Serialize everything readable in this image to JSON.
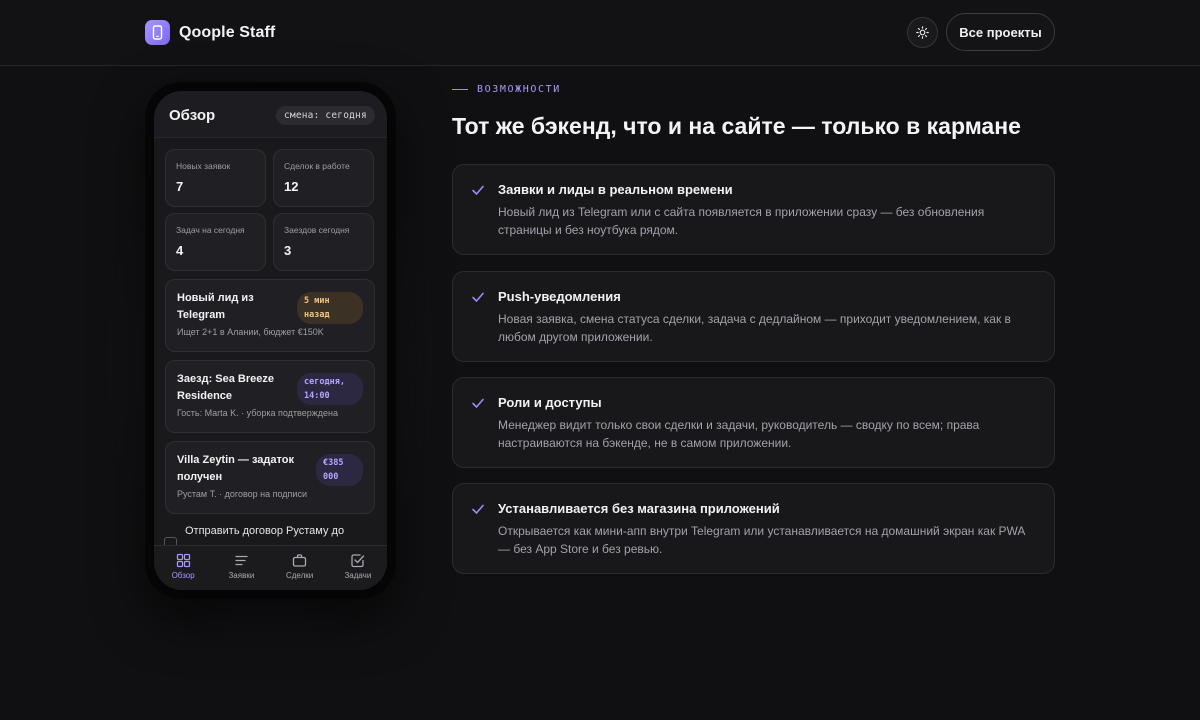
{
  "header": {
    "brand_name": "Qoople Staff",
    "projects_button": "Все проекты"
  },
  "colors": {
    "background": "#101012",
    "accent": "#8b76f5",
    "warm_badge": "#f0c482"
  },
  "phone": {
    "title": "Обзор",
    "shift_pill": "смена: сегодня",
    "stats": [
      {
        "label": "Новых заявок",
        "value": "7"
      },
      {
        "label": "Сделок в работе",
        "value": "12"
      },
      {
        "label": "Задач на сегодня",
        "value": "4"
      },
      {
        "label": "Заездов сегодня",
        "value": "3"
      }
    ],
    "feed": [
      {
        "title": "Новый лид из Telegram",
        "badge": "5 мин назад",
        "subtitle": "Ищет 2+1 в Алании, бюджет €150K"
      },
      {
        "title": "Заезд: Sea Breeze Residence",
        "badge": "сегодня, 14:00",
        "subtitle": "Гость: Marta K. · уборка подтверждена"
      },
      {
        "title": "Villa Zeytin — задаток получен",
        "badge": "€385 000",
        "subtitle": "Рустам Т. · договор на подписи"
      }
    ],
    "task": "Отправить договор Рустаму до",
    "tabs": [
      {
        "label": "Обзор",
        "icon": "grid-icon"
      },
      {
        "label": "Заявки",
        "icon": "list-icon"
      },
      {
        "label": "Сделки",
        "icon": "briefcase-icon"
      },
      {
        "label": "Задачи",
        "icon": "checkbox-icon"
      }
    ]
  },
  "features_section": {
    "eyebrow": "ВОЗМОЖНОСТИ",
    "headline": "Тот же бэкенд, что и на сайте — только в кармане",
    "items": [
      {
        "title": "Заявки и лиды в реальном времени",
        "description": "Новый лид из Telegram или с сайта появляется в приложении сразу — без обновления страницы и без ноутбука рядом."
      },
      {
        "title": "Push-уведомления",
        "description": "Новая заявка, смена статуса сделки, задача с дедлайном — приходит уведомлением, как в любом другом приложении."
      },
      {
        "title": "Роли и доступы",
        "description": "Менеджер видит только свои сделки и задачи, руководитель — сводку по всем; права настраиваются на бэкенде, не в самом приложении."
      },
      {
        "title": "Устанавливается без магазина приложений",
        "description": "Открывается как мини-апп внутри Telegram или устанавливается на домашний экран как PWA — без App Store и без ревью."
      }
    ]
  }
}
